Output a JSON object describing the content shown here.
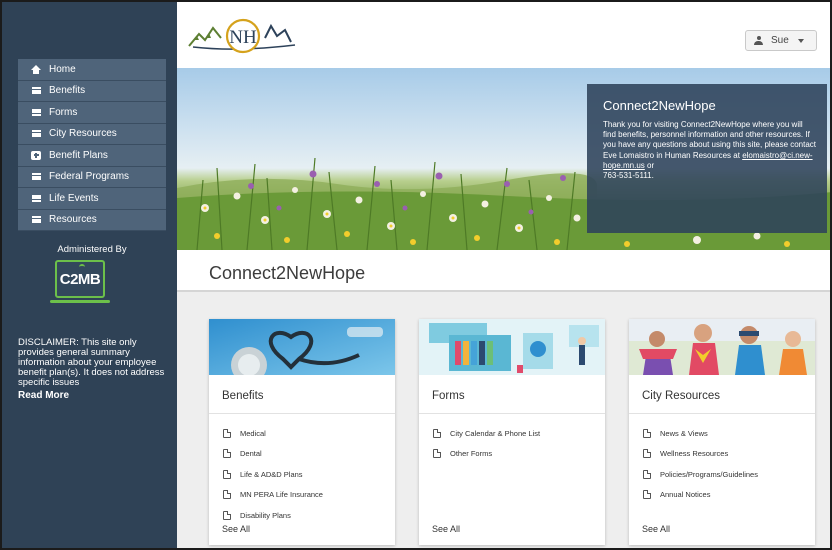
{
  "sidebar": {
    "items": [
      {
        "label": "Home",
        "icon": "home-icon"
      },
      {
        "label": "Benefits",
        "icon": "menu-icon"
      },
      {
        "label": "Forms",
        "icon": "menu-icon"
      },
      {
        "label": "City Resources",
        "icon": "menu-icon"
      },
      {
        "label": "Benefit Plans",
        "icon": "medical-kit-icon"
      },
      {
        "label": "Federal Programs",
        "icon": "menu-icon"
      },
      {
        "label": "Life Events",
        "icon": "menu-icon"
      },
      {
        "label": "Resources",
        "icon": "menu-icon"
      }
    ],
    "administered_by": "Administered By",
    "admin_logo_text": "C2MB",
    "disclaimer": "DISCLAIMER: This site only provides general summary information about your employee benefit plan(s). It does not address specific issues",
    "read_more": "Read More"
  },
  "header": {
    "logo_text": "NH",
    "user_label": "Sue"
  },
  "hero": {
    "title": "Connect2NewHope",
    "body": "Thank you for visiting Connect2NewHope where you will find benefits, personnel information and other resources. If you have any questions about using this site, please contact Eve Lomaistro in Human Resources at",
    "email": "elomaistro@ci.new-hope.mn.us",
    "or": " or",
    "phone": "763-531-5111."
  },
  "page_title": "Connect2NewHope",
  "cards": [
    {
      "title": "Benefits",
      "items": [
        "Medical",
        "Dental",
        "Life & AD&D Plans",
        "MN PERA Life Insurance",
        "Disability Plans"
      ],
      "see_all": "See All"
    },
    {
      "title": "Forms",
      "items": [
        "City Calendar & Phone List",
        "Other Forms"
      ],
      "see_all": "See All"
    },
    {
      "title": "City Resources",
      "items": [
        "News & Views",
        "Wellness Resources",
        "Policies/Programs/Guidelines",
        "Annual Notices"
      ],
      "see_all": "See All"
    }
  ],
  "colors": {
    "sidebar_bg": "#2f4256",
    "nav_item_bg": "#4f647a",
    "logo_green": "#6cc04a",
    "hero_box": "#2d425a"
  }
}
